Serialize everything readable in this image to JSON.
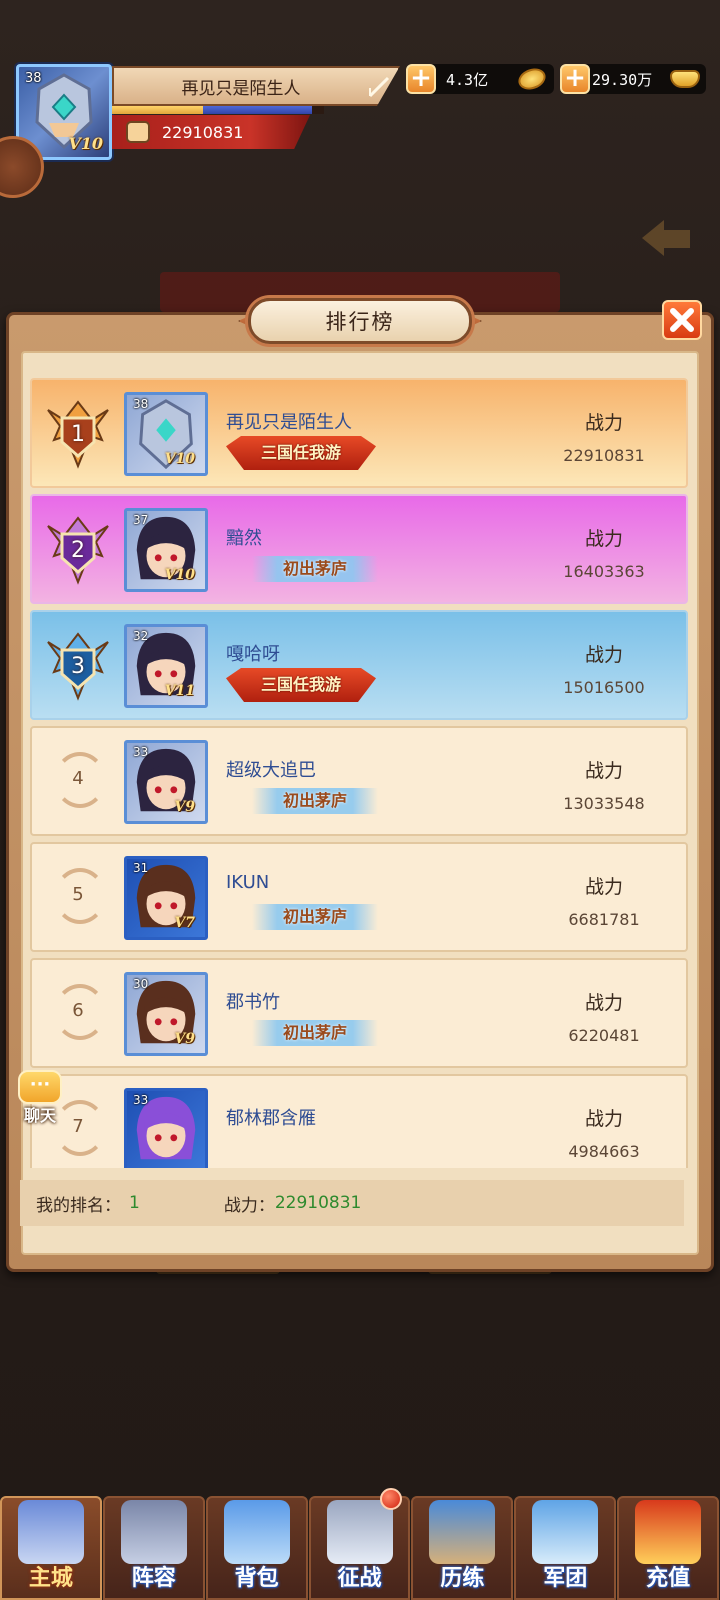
{
  "player": {
    "name": "再见只是陌生人",
    "level": "38",
    "vip": "V10",
    "power": "22910831",
    "xp_progress": 0.43
  },
  "currency": {
    "copper": "4.3亿",
    "ingot": "29.30万"
  },
  "panel": {
    "title": "排行榜",
    "stat_label": "战力"
  },
  "rankings": [
    {
      "rank": "1",
      "name": "再见只是陌生人",
      "level": "38",
      "vip": "V10",
      "badge": "三国任我游",
      "badge_style": "red",
      "power": "22910831"
    },
    {
      "rank": "2",
      "name": "黯然",
      "level": "37",
      "vip": "V10",
      "badge": "初出茅庐",
      "badge_style": "blue",
      "power": "16403363"
    },
    {
      "rank": "3",
      "name": "嘎哈呀",
      "level": "32",
      "vip": "V11",
      "badge": "三国任我游",
      "badge_style": "red",
      "power": "15016500"
    },
    {
      "rank": "4",
      "name": "超级大追巴",
      "level": "33",
      "vip": "V9",
      "badge": "初出茅庐",
      "badge_style": "blue",
      "power": "13033548"
    },
    {
      "rank": "5",
      "name": "IKUN",
      "level": "31",
      "vip": "V7",
      "badge": "初出茅庐",
      "badge_style": "blue",
      "power": "6681781"
    },
    {
      "rank": "6",
      "name": "郡书竹",
      "level": "30",
      "vip": "V9",
      "badge": "初出茅庐",
      "badge_style": "blue",
      "power": "6220481"
    },
    {
      "rank": "7",
      "name": "郁林郡含雁",
      "level": "33",
      "vip": "",
      "badge": "",
      "badge_style": "",
      "power": "4984663"
    }
  ],
  "my_rank": {
    "rank_label": "我的排名：",
    "rank_value": "1",
    "power_label": "战力：",
    "power_value": "22910831"
  },
  "chat": {
    "label": "聊天"
  },
  "bottom_nav": [
    {
      "label": "主城",
      "active": true
    },
    {
      "label": "阵容"
    },
    {
      "label": "背包"
    },
    {
      "label": "征战",
      "badge": true
    },
    {
      "label": "历练"
    },
    {
      "label": "军团"
    },
    {
      "label": "充值"
    }
  ],
  "colors": {
    "accent_gold": "#f7b36c",
    "rank2_purple": "#e86ae8",
    "rank3_blue": "#7ac0e8",
    "my_power_green": "#2e8a2e"
  }
}
